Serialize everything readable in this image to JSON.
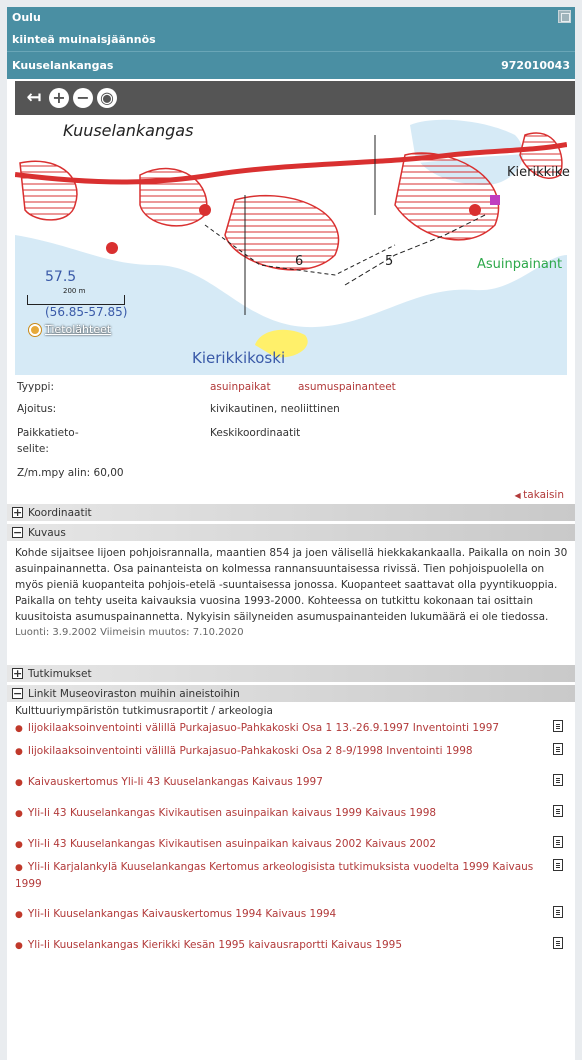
{
  "header": {
    "municipality": "Oulu",
    "category": "kiinteä muinaisjäännös",
    "name": "Kuuselankangas",
    "id": "972010043"
  },
  "map": {
    "toolbar": [
      "back-icon",
      "zoom-in-icon",
      "zoom-out-icon",
      "locate-icon"
    ],
    "labels": {
      "place": "Kuuselankangas",
      "river": "Kierikkikoski",
      "kierikki": "Kierikkike",
      "asuin": "Asuinpainant",
      "elev": "57.5",
      "elev2": "(56.85-57.85)",
      "scale": "200 m",
      "source": "Tietolähteet",
      "num6": "6",
      "num5": "5"
    }
  },
  "info": {
    "type_label": "Tyyppi:",
    "type_values": [
      "asuinpaikat",
      "asumuspainanteet"
    ],
    "dating_label": "Ajoitus:",
    "dating_value": "kivikautinen, neoliittinen",
    "gis_label_1": "Paikkatieto-",
    "gis_label_2": "selite:",
    "gis_value": "Keskikoordinaatit",
    "zm": "Z/m.mpy alin: 60,00",
    "back": "takaisin"
  },
  "sections": {
    "coords": "Koordinaatit",
    "desc": "Kuvaus",
    "research": "Tutkimukset",
    "links": "Linkit Museoviraston muihin aineistoihin"
  },
  "description": {
    "text": "Kohde sijaitsee Iijoen pohjoisrannalla, maantien 854 ja joen välisellä hiekkakankaalla. Paikalla on noin 30 asuinpainannetta. Osa painanteista on kolmessa rannansuuntaisessa rivissä. Tien pohjoispuolella on myös pieniä kuopanteita pohjois-etelä -suuntaisessa jonossa. Kuopanteet saattavat olla pyyntikuoppia. Paikalla on tehty useita kaivauksia vuosina 1993-2000. Kohteessa on tutkittu kokonaan tai osittain kuusitoista asumuspainannetta. Nykyisin säilyneiden asumuspainanteiden lukumäärä ei ole tiedossa.",
    "meta": "Luonti: 3.9.2002 Viimeisin muutos: 7.10.2020"
  },
  "links": {
    "subtitle": "Kulttuuriympäristön tutkimusraportit / arkeologia",
    "items": [
      "Iijokilaaksoinventointi välillä Purkajasuo-Pahkakoski Osa 1 13.-26.9.1997 Inventointi 1997",
      "Iijokilaaksoinventointi välillä Purkajasuo-Pahkakoski Osa 2 8-9/1998 Inventointi 1998",
      "Kaivauskertomus Yli-Ii 43 Kuuselankangas Kaivaus 1997",
      "Yli-Ii 43 Kuuselankangas Kivikautisen asuinpaikan kaivaus 1999 Kaivaus 1998",
      "Yli-Ii 43 Kuuselankangas Kivikautisen asuinpaikan kaivaus 2002 Kaivaus 2002",
      "Yli-Ii Karjalankylä Kuuselankangas Kertomus arkeologisista tutkimuksista vuodelta 1999 Kaivaus 1999",
      "Yli-Ii Kuuselankangas Kaivauskertomus 1994 Kaivaus 1994",
      "Yli-Ii Kuuselankangas Kierikki Kesän 1995 kaivausraportti Kaivaus 1995"
    ]
  },
  "colors": {
    "header_bg": "#4a8fa3",
    "link": "#b23a3a",
    "map_water": "#d6eaf6",
    "map_hatch": "#d93030"
  }
}
